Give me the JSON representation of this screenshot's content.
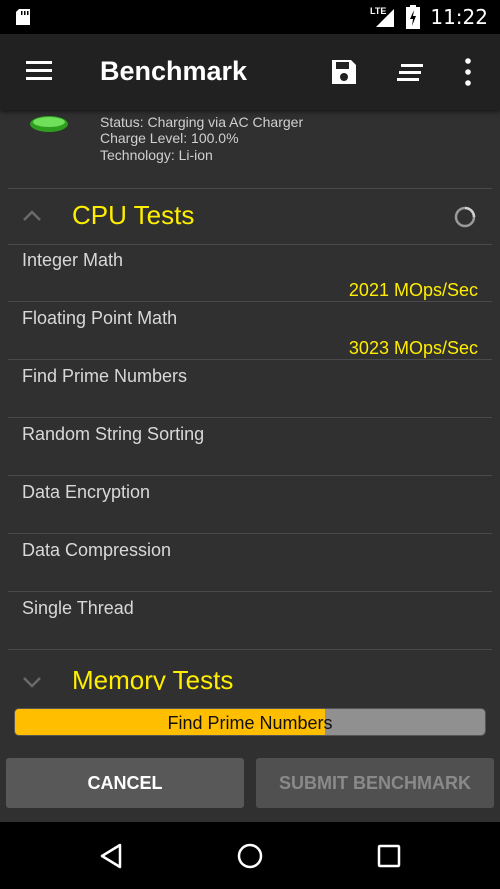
{
  "statusbar": {
    "time": "11:22",
    "network": "LTE"
  },
  "toolbar": {
    "title": "Benchmark"
  },
  "battery": {
    "status": "Status: Charging via AC Charger",
    "charge": "Charge Level: 100.0%",
    "technology": "Technology: Li-ion"
  },
  "cpu": {
    "title": "CPU Tests",
    "tests": [
      {
        "label": "Integer Math",
        "value": "2021 MOps/Sec"
      },
      {
        "label": "Floating Point Math",
        "value": "3023 MOps/Sec"
      },
      {
        "label": "Find Prime Numbers",
        "value": ""
      },
      {
        "label": "Random String Sorting",
        "value": ""
      },
      {
        "label": "Data Encryption",
        "value": ""
      },
      {
        "label": "Data Compression",
        "value": ""
      },
      {
        "label": "Single Thread",
        "value": ""
      }
    ]
  },
  "memory": {
    "title": "Memory Tests"
  },
  "progress": {
    "label": "Find Prime Numbers",
    "fraction": 0.66
  },
  "buttons": {
    "cancel": "CANCEL",
    "submit": "SUBMIT BENCHMARK"
  },
  "colors": {
    "accent": "#ffee00",
    "progress": "#ffbf00"
  }
}
